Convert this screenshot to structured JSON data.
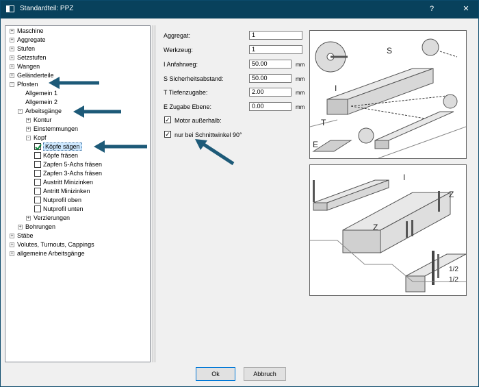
{
  "window": {
    "title": "Standardteil: PPZ",
    "help_label": "?",
    "close_label": "✕"
  },
  "tree": {
    "items": [
      {
        "label": "Maschine",
        "level": 0,
        "expander": "+"
      },
      {
        "label": "Aggregate",
        "level": 0,
        "expander": "+"
      },
      {
        "label": "Stufen",
        "level": 0,
        "expander": "+"
      },
      {
        "label": "Setzstufen",
        "level": 0,
        "expander": "+"
      },
      {
        "label": "Wangen",
        "level": 0,
        "expander": "+"
      },
      {
        "label": "Geländerteile",
        "level": 0,
        "expander": "+"
      },
      {
        "label": "Pfosten",
        "level": 0,
        "expander": "-"
      },
      {
        "label": "Allgemein 1",
        "level": 1
      },
      {
        "label": "Allgemein 2",
        "level": 1
      },
      {
        "label": "Arbeitsgänge",
        "level": 1,
        "expander": "-"
      },
      {
        "label": "Kontur",
        "level": 2,
        "expander": "+"
      },
      {
        "label": "Einstemmungen",
        "level": 2,
        "expander": "+"
      },
      {
        "label": "Kopf",
        "level": 2,
        "expander": "-"
      },
      {
        "label": "Köpfe sägen",
        "level": 3,
        "checked": true,
        "selected": true
      },
      {
        "label": "Köpfe fräsen",
        "level": 3,
        "checked": false
      },
      {
        "label": "Zapfen 5-Achs fräsen",
        "level": 3,
        "checked": false
      },
      {
        "label": "Zapfen 3-Achs fräsen",
        "level": 3,
        "checked": false
      },
      {
        "label": "Austritt Minizinken",
        "level": 3,
        "checked": false
      },
      {
        "label": "Antritt  Minizinken",
        "level": 3,
        "checked": false
      },
      {
        "label": "Nutprofil oben",
        "level": 3,
        "checked": false
      },
      {
        "label": "Nutprofil unten",
        "level": 3,
        "checked": false
      },
      {
        "label": "Verzierungen",
        "level": 2,
        "expander": "+"
      },
      {
        "label": "Bohrungen",
        "level": 1,
        "expander": "+"
      },
      {
        "label": "Stäbe",
        "level": 0,
        "expander": "+"
      },
      {
        "label": "Volutes, Turnouts, Cappings",
        "level": 0,
        "expander": "+"
      },
      {
        "label": "allgemeine Arbeitsgänge",
        "level": 0,
        "expander": "+"
      }
    ]
  },
  "form": {
    "aggregat_label": "Aggregat:",
    "aggregat_value": "1",
    "werkzeug_label": "Werkzeug:",
    "werkzeug_value": "1",
    "anfahrweg_label": "I  Anfahrweg:",
    "anfahrweg_value": "50.00",
    "anfahrweg_unit": "mm",
    "sicherheit_label": "S  Sicherheitsabstand:",
    "sicherheit_value": "50.00",
    "sicherheit_unit": "mm",
    "tiefen_label": "T  Tiefenzugabe:",
    "tiefen_value": "2.00",
    "tiefen_unit": "mm",
    "ebene_label": "E  Zugabe Ebene:",
    "ebene_value": "0.00",
    "ebene_unit": "mm",
    "motor_label": "Motor außerhalb:",
    "motor_checked": true,
    "schnitt_label": "nur bei Schnittwinkel 90°",
    "schnitt_checked": true
  },
  "diagram_top": {
    "labels": [
      "S",
      "I",
      "T",
      "E"
    ]
  },
  "diagram_bottom": {
    "labels": [
      "I",
      "Z",
      "Z",
      "1/2",
      "1/2"
    ]
  },
  "buttons": {
    "ok_label": "Ok",
    "cancel_label": "Abbruch"
  },
  "colors": {
    "titlebar": "#08415c",
    "annotation_arrow": "#1d5a78",
    "selection": "#cde8ff",
    "check": "#0a8a3a"
  }
}
